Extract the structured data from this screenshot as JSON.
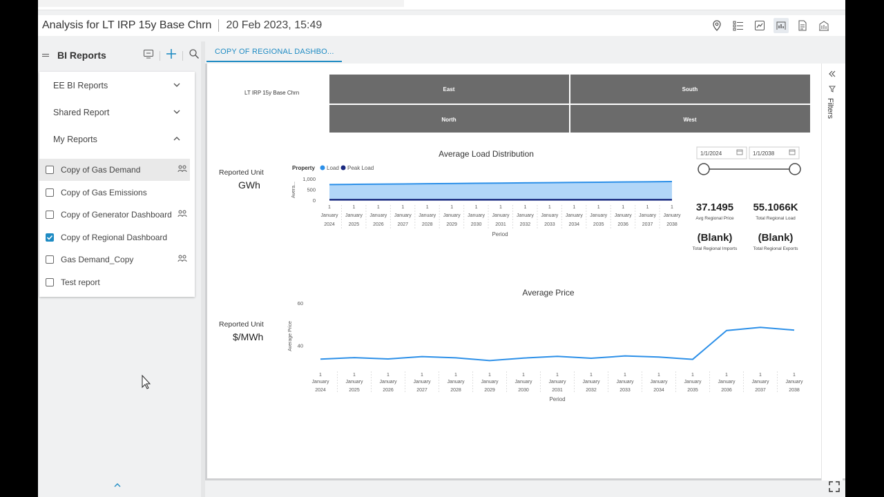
{
  "header": {
    "title": "Analysis for LT IRP 15y Base Chrn",
    "timestamp": "20 Feb 2023, 15:49",
    "tools": [
      "location-pin-icon",
      "list-icon",
      "chart-image-icon",
      "report-icon",
      "document-icon",
      "building-chart-icon"
    ]
  },
  "sidebar": {
    "title": "BI Reports",
    "sections": [
      {
        "label": "EE BI Reports",
        "expanded": false
      },
      {
        "label": "Shared Report",
        "expanded": false
      },
      {
        "label": "My Reports",
        "expanded": true
      }
    ],
    "reports": [
      {
        "label": "Copy of Gas Demand",
        "checked": false,
        "shared": true,
        "highlighted": true
      },
      {
        "label": "Copy of Gas Emissions",
        "checked": false,
        "shared": false,
        "highlighted": false
      },
      {
        "label": "Copy of Generator Dashboard",
        "checked": false,
        "shared": true,
        "highlighted": false
      },
      {
        "label": "Copy of Regional Dashboard",
        "checked": true,
        "shared": false,
        "highlighted": false
      },
      {
        "label": "Gas Demand_Copy",
        "checked": false,
        "shared": true,
        "highlighted": false
      },
      {
        "label": "Test report",
        "checked": false,
        "shared": false,
        "highlighted": false
      }
    ]
  },
  "tab": {
    "label": "COPY OF REGIONAL DASHBO..."
  },
  "filters": {
    "label": "Filters"
  },
  "dashboard": {
    "scenario": "LT IRP 15y Base Chrn",
    "regions": [
      "East",
      "South",
      "North",
      "West"
    ],
    "load_unit_label": "Reported Unit",
    "load_unit": "GWh",
    "price_unit_label": "Reported Unit",
    "price_unit": "$/MWh",
    "date_from": "1/1/2024",
    "date_to": "1/1/2038",
    "kpis": [
      {
        "value": "37.1495",
        "label": "Avg Regional Price"
      },
      {
        "value": "55.1066K",
        "label": "Total Regional Load"
      },
      {
        "value": "(Blank)",
        "label": "Total Regional Imports"
      },
      {
        "value": "(Blank)",
        "label": "Total Regional Exports"
      }
    ],
    "colors": {
      "load": "#2b8fe8",
      "load_fill": "#a9d2f7",
      "peak": "#1a2a80",
      "price": "#2b8fe8",
      "region_tile": "#6b6b6b"
    }
  },
  "chart_data": [
    {
      "type": "area",
      "title": "Average Load Distribution",
      "legend_title": "Property",
      "series": [
        {
          "name": "Load",
          "values": [
            730,
            740,
            750,
            760,
            770,
            780,
            790,
            800,
            810,
            820,
            830,
            840,
            850,
            860,
            870
          ]
        },
        {
          "name": "Peak Load",
          "values": [
            20,
            20,
            20,
            20,
            20,
            20,
            20,
            20,
            20,
            20,
            20,
            20,
            20,
            20,
            20
          ]
        }
      ],
      "categories": [
        "1 January 2024",
        "1 January 2025",
        "1 January 2026",
        "1 January 2027",
        "1 January 2028",
        "1 January 2029",
        "1 January 2030",
        "1 January 2031",
        "1 January 2032",
        "1 January 2033",
        "1 January 2034",
        "1 January 2035",
        "1 January 2036",
        "1 January 2037",
        "1 January 2038"
      ],
      "tick_top": "1",
      "tick_mid": "January",
      "tick_years": [
        "2024",
        "2025",
        "2026",
        "2027",
        "2028",
        "2029",
        "2030",
        "2031",
        "2032",
        "2033",
        "2034",
        "2035",
        "2036",
        "2037",
        "2038"
      ],
      "y_ticks": [
        "0",
        "500",
        "1,000"
      ],
      "ylim": [
        0,
        1000
      ],
      "ylabel": "Avera...",
      "xlabel": "Period",
      "legend": "top-left"
    },
    {
      "type": "line",
      "title": "Average Price",
      "series": [
        {
          "name": "Average Price",
          "values": [
            33.5,
            34.2,
            33.6,
            34.7,
            34.1,
            32.8,
            34.0,
            34.8,
            33.9,
            35.0,
            34.5,
            33.4,
            47.0,
            48.5,
            47.2
          ]
        }
      ],
      "categories": [
        "1 January 2024",
        "1 January 2025",
        "1 January 2026",
        "1 January 2027",
        "1 January 2028",
        "1 January 2029",
        "1 January 2030",
        "1 January 2031",
        "1 January 2032",
        "1 January 2033",
        "1 January 2034",
        "1 January 2035",
        "1 January 2036",
        "1 January 2037",
        "1 January 2038"
      ],
      "tick_top": "1",
      "tick_mid": "January",
      "tick_years": [
        "2024",
        "2025",
        "2026",
        "2027",
        "2028",
        "2029",
        "2030",
        "2031",
        "2032",
        "2033",
        "2034",
        "2035",
        "2036",
        "2037",
        "2038"
      ],
      "y_ticks": [
        "40",
        "60"
      ],
      "ylim": [
        30,
        60
      ],
      "ylabel": "Average Price",
      "xlabel": "Period"
    }
  ]
}
